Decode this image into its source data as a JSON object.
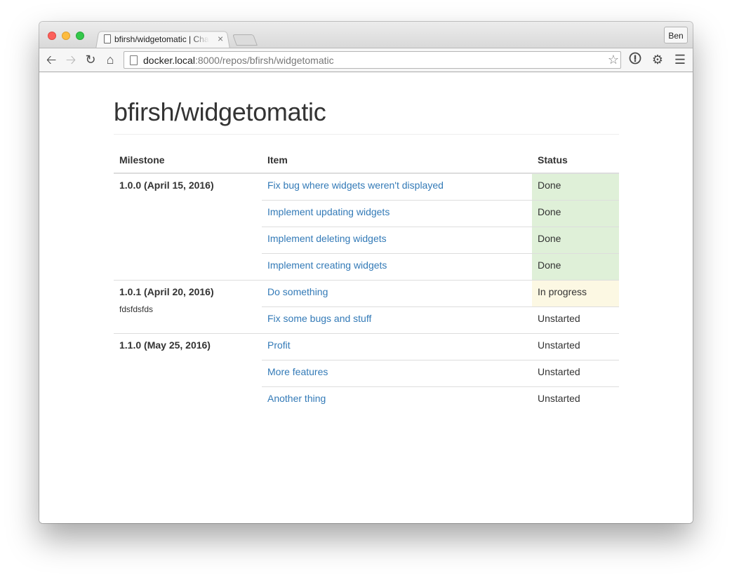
{
  "browser": {
    "tab_title": "bfirsh/widgetomatic | Changes",
    "tab_close": "×",
    "profile": "Ben",
    "url_host": "docker.local",
    "url_rest": ":8000/repos/bfirsh/widgetomatic",
    "icons": [
      "back-icon",
      "forward-icon",
      "reload-icon",
      "home-icon",
      "star-icon",
      "extension-icon",
      "settings-icon",
      "menu-icon"
    ]
  },
  "page": {
    "title": "bfirsh/widgetomatic",
    "columns": {
      "milestone": "Milestone",
      "item": "Item",
      "status": "Status"
    },
    "milestones": [
      {
        "name": "1.0.0 (April 15, 2016)",
        "note": "",
        "items": [
          {
            "title": "Fix bug where widgets weren't displayed",
            "status": "Done"
          },
          {
            "title": "Implement updating widgets",
            "status": "Done"
          },
          {
            "title": "Implement deleting widgets",
            "status": "Done"
          },
          {
            "title": "Implement creating widgets",
            "status": "Done"
          }
        ]
      },
      {
        "name": "1.0.1 (April 20, 2016)",
        "note": "fdsfdsfds",
        "items": [
          {
            "title": "Do something",
            "status": "In progress"
          },
          {
            "title": "Fix some bugs and stuff",
            "status": "Unstarted"
          }
        ]
      },
      {
        "name": "1.1.0 (May 25, 2016)",
        "note": "",
        "items": [
          {
            "title": "Profit",
            "status": "Unstarted"
          },
          {
            "title": "More features",
            "status": "Unstarted"
          },
          {
            "title": "Another thing",
            "status": "Unstarted"
          }
        ]
      }
    ]
  },
  "colors": {
    "link": "#337ab7",
    "done_bg": "#dff0d8",
    "in_progress_bg": "#fcf8e3"
  }
}
